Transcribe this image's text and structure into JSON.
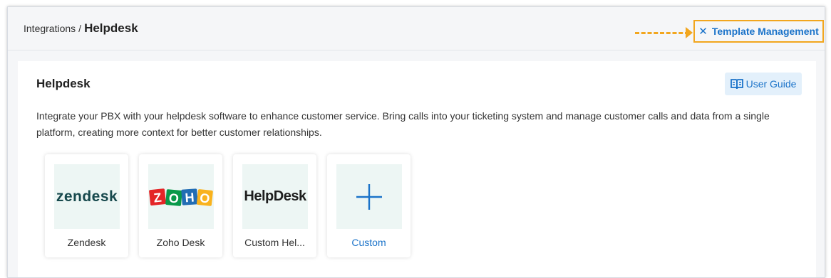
{
  "breadcrumb": {
    "parent": "Integrations",
    "separator": "/",
    "current": "Helpdesk"
  },
  "header": {
    "template_management_label": "Template Management",
    "template_management_icon": "tools-icon"
  },
  "section": {
    "title": "Helpdesk",
    "user_guide_label": "User Guide",
    "user_guide_icon": "book-icon",
    "description": "Integrate your PBX with your helpdesk software to enhance customer service. Bring calls into your ticketing system and manage customer calls and data from a single platform, creating more context for better customer relationships."
  },
  "integrations": [
    {
      "name": "Zendesk",
      "logo_text": "zendesk"
    },
    {
      "name": "Zoho Desk",
      "logo_letters": [
        "Z",
        "O",
        "H",
        "O"
      ],
      "logo_colors": [
        "#e42527",
        "#089949",
        "#226db4",
        "#f9b21d"
      ]
    },
    {
      "name": "Custom Hel...",
      "logo_text": "HelpDesk"
    },
    {
      "name": "Custom",
      "logo_icon": "plus-icon"
    }
  ],
  "colors": {
    "accent": "#1b73c9",
    "highlight": "#f2a61e",
    "logo_bg": "#edf6f4"
  }
}
